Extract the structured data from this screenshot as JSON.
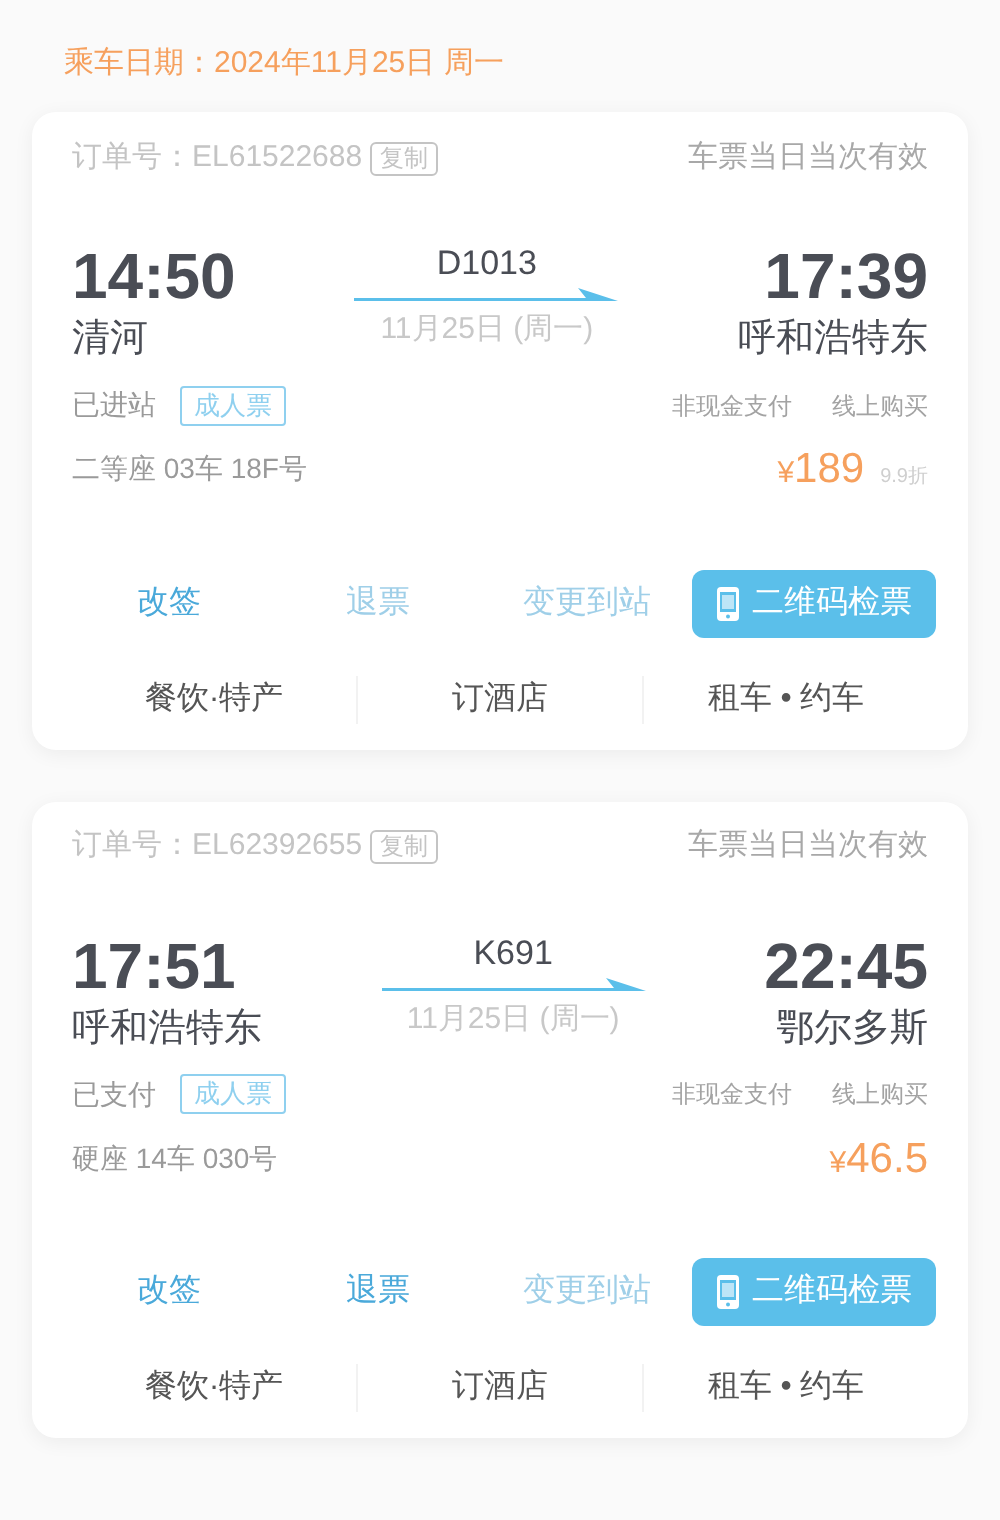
{
  "travel_date": "乘车日期：2024年11月25日 周一",
  "orders": [
    {
      "order_label": "订单号：",
      "order_no": "EL61522688",
      "copy": "复制",
      "validity": "车票当日当次有效",
      "depart_time": "14:50",
      "depart_station": "清河",
      "train": "D1013",
      "date": "11月25日 (周一)",
      "arrive_time": "17:39",
      "arrive_station": "呼和浩特东",
      "status": "已进站",
      "ticket_type": "成人票",
      "payment": "非现金支付",
      "channel": "线上购买",
      "seat": "二等座 03车 18F号",
      "currency": "¥",
      "price": "189",
      "discount": "9.9折",
      "actions": [
        {
          "kind": "text",
          "label": "改签",
          "disabled": false
        },
        {
          "kind": "text",
          "label": "退票",
          "disabled": true
        },
        {
          "kind": "text",
          "label": "变更到站",
          "disabled": true
        },
        {
          "kind": "primary",
          "label": "二维码检票",
          "disabled": false
        }
      ],
      "services": [
        "餐饮·特产",
        "订酒店",
        "租车 • 约车"
      ]
    },
    {
      "order_label": "订单号：",
      "order_no": "EL62392655",
      "copy": "复制",
      "validity": "车票当日当次有效",
      "depart_time": "17:51",
      "depart_station": "呼和浩特东",
      "train": "K691",
      "date": "11月25日 (周一)",
      "arrive_time": "22:45",
      "arrive_station": "鄂尔多斯",
      "status": "已支付",
      "ticket_type": "成人票",
      "payment": "非现金支付",
      "channel": "线上购买",
      "seat": "硬座 14车 030号",
      "currency": "¥",
      "price": "46.5",
      "actions": [
        {
          "kind": "text",
          "label": "改签",
          "disabled": false
        },
        {
          "kind": "text",
          "label": "退票",
          "disabled": false
        },
        {
          "kind": "text",
          "label": "变更到站",
          "disabled": true
        },
        {
          "kind": "primary",
          "label": "二维码检票",
          "disabled": false
        }
      ],
      "services": [
        "餐饮·特产",
        "订酒店",
        "租车 • 约车"
      ]
    }
  ]
}
